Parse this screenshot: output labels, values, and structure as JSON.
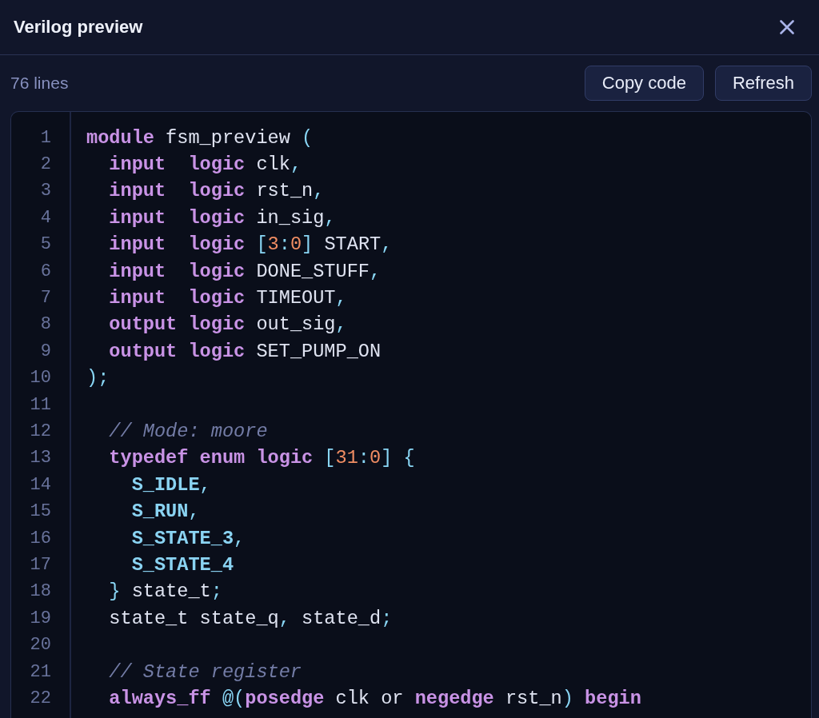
{
  "window": {
    "title": "Verilog preview"
  },
  "toolbar": {
    "line_count": "76 lines",
    "buttons": [
      "Copy code",
      "Refresh"
    ]
  },
  "code": {
    "lines": [
      {
        "number": "1",
        "tokens": [
          {
            "text": "module",
            "kind": "keyword"
          },
          {
            "text": " fsm_preview ",
            "kind": "plain"
          },
          {
            "text": "(",
            "kind": "punct"
          }
        ]
      },
      {
        "number": "2",
        "tokens": [
          {
            "text": "  input  ",
            "kind": "keyword"
          },
          {
            "text": "logic",
            "kind": "keyword"
          },
          {
            "text": " clk",
            "kind": "plain"
          },
          {
            "text": ",",
            "kind": "punct"
          }
        ]
      },
      {
        "number": "3",
        "tokens": [
          {
            "text": "  input  ",
            "kind": "keyword"
          },
          {
            "text": "logic",
            "kind": "keyword"
          },
          {
            "text": " rst_n",
            "kind": "plain"
          },
          {
            "text": ",",
            "kind": "punct"
          }
        ]
      },
      {
        "number": "4",
        "tokens": [
          {
            "text": "  input  ",
            "kind": "keyword"
          },
          {
            "text": "logic",
            "kind": "keyword"
          },
          {
            "text": " in_sig",
            "kind": "plain"
          },
          {
            "text": ",",
            "kind": "punct"
          }
        ]
      },
      {
        "number": "5",
        "tokens": [
          {
            "text": "  input  ",
            "kind": "keyword"
          },
          {
            "text": "logic ",
            "kind": "keyword"
          },
          {
            "text": "[",
            "kind": "punct"
          },
          {
            "text": "3",
            "kind": "number"
          },
          {
            "text": ":",
            "kind": "punct"
          },
          {
            "text": "0",
            "kind": "number"
          },
          {
            "text": "]",
            "kind": "punct"
          },
          {
            "text": " START",
            "kind": "plain"
          },
          {
            "text": ",",
            "kind": "punct"
          }
        ]
      },
      {
        "number": "6",
        "tokens": [
          {
            "text": "  input  ",
            "kind": "keyword"
          },
          {
            "text": "logic",
            "kind": "keyword"
          },
          {
            "text": " DONE_STUFF",
            "kind": "plain"
          },
          {
            "text": ",",
            "kind": "punct"
          }
        ]
      },
      {
        "number": "7",
        "tokens": [
          {
            "text": "  input  ",
            "kind": "keyword"
          },
          {
            "text": "logic",
            "kind": "keyword"
          },
          {
            "text": " TIMEOUT",
            "kind": "plain"
          },
          {
            "text": ",",
            "kind": "punct"
          }
        ]
      },
      {
        "number": "8",
        "tokens": [
          {
            "text": "  output ",
            "kind": "keyword"
          },
          {
            "text": "logic",
            "kind": "keyword"
          },
          {
            "text": " out_sig",
            "kind": "plain"
          },
          {
            "text": ",",
            "kind": "punct"
          }
        ]
      },
      {
        "number": "9",
        "tokens": [
          {
            "text": "  output ",
            "kind": "keyword"
          },
          {
            "text": "logic",
            "kind": "keyword"
          },
          {
            "text": " SET_PUMP_ON",
            "kind": "plain"
          }
        ]
      },
      {
        "number": "10",
        "tokens": [
          {
            "text": ");",
            "kind": "punct"
          }
        ]
      },
      {
        "number": "11"
      },
      {
        "number": "12",
        "tokens": [
          {
            "text": "  // Mode: moore",
            "kind": "comment"
          }
        ]
      },
      {
        "number": "13",
        "tokens": [
          {
            "text": "  typedef ",
            "kind": "keyword"
          },
          {
            "text": "enum ",
            "kind": "keyword"
          },
          {
            "text": "logic ",
            "kind": "keyword"
          },
          {
            "text": "[",
            "kind": "punct"
          },
          {
            "text": "31",
            "kind": "number"
          },
          {
            "text": ":",
            "kind": "punct"
          },
          {
            "text": "0",
            "kind": "number"
          },
          {
            "text": "] {",
            "kind": "punct"
          }
        ]
      },
      {
        "number": "14",
        "tokens": [
          {
            "text": "    S_IDLE",
            "kind": "constant"
          },
          {
            "text": ",",
            "kind": "punct"
          }
        ]
      },
      {
        "number": "15",
        "tokens": [
          {
            "text": "    S_RUN",
            "kind": "constant"
          },
          {
            "text": ",",
            "kind": "punct"
          }
        ]
      },
      {
        "number": "16",
        "tokens": [
          {
            "text": "    S_STATE_3",
            "kind": "constant"
          },
          {
            "text": ",",
            "kind": "punct"
          }
        ]
      },
      {
        "number": "17",
        "tokens": [
          {
            "text": "    S_STATE_4",
            "kind": "constant"
          }
        ]
      },
      {
        "number": "18",
        "tokens": [
          {
            "text": "  }",
            "kind": "punct"
          },
          {
            "text": " state_t",
            "kind": "plain"
          },
          {
            "text": ";",
            "kind": "punct"
          }
        ]
      },
      {
        "number": "19",
        "tokens": [
          {
            "text": "  state_t state_q",
            "kind": "plain"
          },
          {
            "text": ",",
            "kind": "punct"
          },
          {
            "text": " state_d",
            "kind": "plain"
          },
          {
            "text": ";",
            "kind": "punct"
          }
        ]
      },
      {
        "number": "20"
      },
      {
        "number": "21",
        "tokens": [
          {
            "text": "  // State register",
            "kind": "comment"
          }
        ]
      },
      {
        "number": "22",
        "tokens": [
          {
            "text": "  always_ff ",
            "kind": "keyword"
          },
          {
            "text": "@(",
            "kind": "punct"
          },
          {
            "text": "posedge",
            "kind": "keyword"
          },
          {
            "text": " clk or ",
            "kind": "plain"
          },
          {
            "text": "negedge",
            "kind": "keyword"
          },
          {
            "text": " rst_n",
            "kind": "plain"
          },
          {
            "text": ") ",
            "kind": "punct"
          },
          {
            "text": "begin",
            "kind": "keyword"
          }
        ]
      }
    ]
  }
}
